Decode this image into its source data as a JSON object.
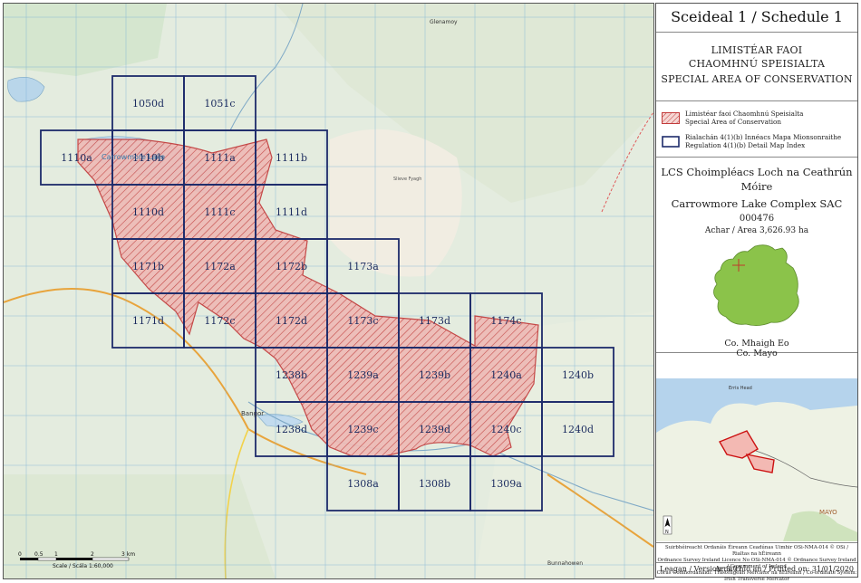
{
  "panel": {
    "title": "Sceideal 1 / Schedule 1",
    "designation_ga_1": "LIMISTÉAR FAOI",
    "designation_ga_2": "CHAOMHNÚ SPEISIALTA",
    "designation_en": "SPECIAL AREA OF CONSERVATION",
    "legend": [
      {
        "ga": "Limistéar faoi Chaomhnú Speisialta",
        "en": "Special Area of Conservation",
        "symbol": "hatch"
      },
      {
        "ga": "Rialachán 4(1)(b) Innéacs Mapa Mionsonraithe",
        "en": "Regulation 4(1)(b) Detail Map Index",
        "symbol": "box"
      }
    ],
    "site_name_ga": "LCS Choimpléacs Loch na Ceathrún Móire",
    "site_name_en": "Carrowmore Lake Complex SAC",
    "site_code": "000476",
    "area": "Achar / Area 3,626.93 ha",
    "county_ga": "Co. Mhaigh Eo",
    "county_en": "Co. Mayo",
    "inset_labels": {
      "town": "Erris Head",
      "county": "MAYO"
    },
    "footer": [
      "Suirbhéireacht Ordanáis Éireann Ceadúnas Uimhir OSi-NMA-014 © OSi / Rialtas na hÉireann",
      "Ordnance Survey Ireland Licence No OSi-NMA-014 © Ordnance Survey Ireland / Government of Ireland",
      "Córas Comhordanáidí: Trasteilgean Mercator na hÉireann / Co-ordinate System: Irish Transverse Mercator"
    ],
    "version": "Leagan / Version: 3.01",
    "printed": "Arna chló an / Printed on: 31/01/2020"
  },
  "map": {
    "place_labels": [
      "Carrowmore Lake",
      "Glenamoy",
      "Bangor",
      "Slieve Fyagh",
      "Bunnahowen"
    ],
    "scale_ticks": [
      "0",
      "0.5",
      "1",
      "2",
      "3 km"
    ],
    "scale_text": "Scale / Scála 1:60,000",
    "colors": {
      "sac_fill": "#e9b4b0",
      "sac_line": "#c23b3b",
      "grid_line": "#1d2b6b",
      "inset_site": "#cc1111"
    },
    "tiles": [
      {
        "id": "1050d",
        "col": 1,
        "row": 0
      },
      {
        "id": "1051c",
        "col": 2,
        "row": 0
      },
      {
        "id": "1110a",
        "col": 0,
        "row": 1
      },
      {
        "id": "1110b",
        "col": 1,
        "row": 1
      },
      {
        "id": "1111a",
        "col": 2,
        "row": 1
      },
      {
        "id": "1111b",
        "col": 3,
        "row": 1
      },
      {
        "id": "1110d",
        "col": 1,
        "row": 2
      },
      {
        "id": "1111c",
        "col": 2,
        "row": 2
      },
      {
        "id": "1111d",
        "col": 3,
        "row": 2
      },
      {
        "id": "1171b",
        "col": 1,
        "row": 3
      },
      {
        "id": "1172a",
        "col": 2,
        "row": 3
      },
      {
        "id": "1172b",
        "col": 3,
        "row": 3
      },
      {
        "id": "1173a",
        "col": 4,
        "row": 3
      },
      {
        "id": "1171d",
        "col": 1,
        "row": 4
      },
      {
        "id": "1172c",
        "col": 2,
        "row": 4
      },
      {
        "id": "1172d",
        "col": 3,
        "row": 4
      },
      {
        "id": "1173c",
        "col": 4,
        "row": 4
      },
      {
        "id": "1173d",
        "col": 5,
        "row": 4
      },
      {
        "id": "1174c",
        "col": 6,
        "row": 4
      },
      {
        "id": "1238b",
        "col": 3,
        "row": 5
      },
      {
        "id": "1239a",
        "col": 4,
        "row": 5
      },
      {
        "id": "1239b",
        "col": 5,
        "row": 5
      },
      {
        "id": "1240a",
        "col": 6,
        "row": 5
      },
      {
        "id": "1240b",
        "col": 7,
        "row": 5
      },
      {
        "id": "1238d",
        "col": 3,
        "row": 6
      },
      {
        "id": "1239c",
        "col": 4,
        "row": 6
      },
      {
        "id": "1239d",
        "col": 5,
        "row": 6
      },
      {
        "id": "1240c",
        "col": 6,
        "row": 6
      },
      {
        "id": "1240d",
        "col": 7,
        "row": 6
      },
      {
        "id": "1308a",
        "col": 4,
        "row": 7
      },
      {
        "id": "1308b",
        "col": 5,
        "row": 7
      },
      {
        "id": "1309a",
        "col": 6,
        "row": 7
      }
    ]
  }
}
